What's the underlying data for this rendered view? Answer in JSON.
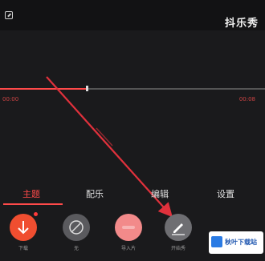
{
  "brand": {
    "logo_text": "抖乐秀"
  },
  "timeline": {
    "current_time": "00:00",
    "total_time": "00:08",
    "progress": 0.33
  },
  "tabs": [
    {
      "label": "主题",
      "active": true
    },
    {
      "label": "配乐",
      "active": false
    },
    {
      "label": "编辑",
      "active": false
    },
    {
      "label": "设置",
      "active": false
    }
  ],
  "tools": [
    {
      "icon": "download-arrow-icon",
      "label": "下载",
      "color": "#f04e30"
    },
    {
      "icon": "no-symbol-icon",
      "label": "无",
      "color": "#5a5a5e"
    },
    {
      "icon": "ellipsis-icon",
      "label": "导入片",
      "color": "#f28a8a"
    },
    {
      "icon": "edit-icon",
      "label": "开始秀",
      "color": "#6e6e72"
    }
  ],
  "watermark": {
    "text": "秋叶下载站"
  },
  "colors": {
    "accent": "#ff4a4a",
    "arrow": "#e0313c"
  }
}
